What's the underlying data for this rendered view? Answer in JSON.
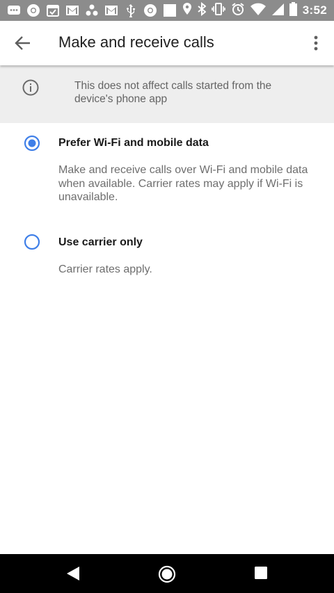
{
  "status_bar": {
    "time": "3:52",
    "left_icons": [
      "chat-icon",
      "chrome-icon",
      "calendar-check-icon",
      "gmail-icon",
      "photos-icon",
      "gmail-icon",
      "usb-icon",
      "chrome-icon",
      "square-icon"
    ],
    "right_icons": [
      "location-icon",
      "bluetooth-icon",
      "vibrate-icon",
      "alarm-icon",
      "wifi-icon",
      "signal-icon",
      "battery-icon"
    ]
  },
  "app_bar": {
    "title": "Make and receive calls",
    "back_icon": "arrow-back-icon",
    "menu_icon": "more-vert-icon"
  },
  "info_banner": {
    "icon": "info-icon",
    "text": "This does not affect calls started from the device's phone app"
  },
  "options": [
    {
      "label": "Prefer Wi-Fi and mobile data",
      "description": "Make and receive calls over Wi-Fi and mobile data when available. Carrier rates may apply if Wi-Fi is unavailable.",
      "selected": true
    },
    {
      "label": "Use carrier only",
      "description": "Carrier rates apply.",
      "selected": false
    }
  ],
  "colors": {
    "accent": "#3f7fe8",
    "status_bar": "#8c8c8c",
    "info_background": "#eeeeee",
    "nav_bar": "#000000"
  },
  "nav_bar": {
    "icons": [
      "nav-back-icon",
      "nav-home-icon",
      "nav-recents-icon"
    ]
  }
}
